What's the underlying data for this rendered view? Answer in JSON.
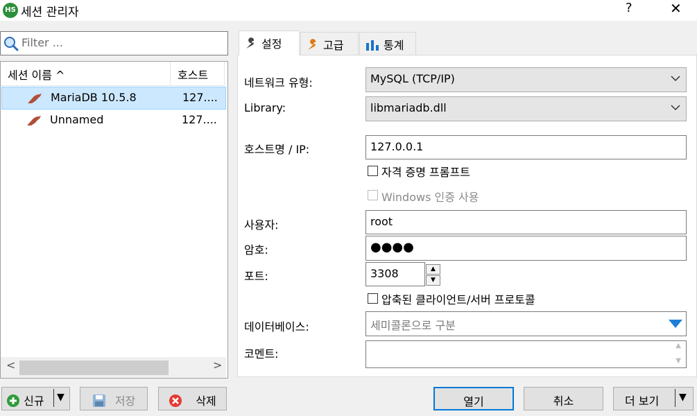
{
  "window": {
    "title": "세션 관리자",
    "help": "?",
    "close": "✕",
    "app_icon": "HS"
  },
  "filter": {
    "placeholder": "Filter ..."
  },
  "list": {
    "columns": [
      "세션 이름 ^",
      "호스트"
    ],
    "rows": [
      {
        "name": "MariaDB 10.5.8",
        "host": "127....",
        "selected": true
      },
      {
        "name": "Unnamed",
        "host": "127....",
        "selected": false
      }
    ],
    "scroll_left": "<",
    "scroll_right": ">"
  },
  "tabs": [
    {
      "label": "설정",
      "icon": "wrench-icon",
      "active": true
    },
    {
      "label": "고급",
      "icon": "wrench-orange-icon",
      "active": false
    },
    {
      "label": "통계",
      "icon": "bar-chart-icon",
      "active": false
    }
  ],
  "form": {
    "network_type_label": "네트워크 유형:",
    "network_type_value": "MySQL (TCP/IP)",
    "library_label": "Library:",
    "library_value": "libmariadb.dll",
    "host_label": "호스트명 / IP:",
    "host_value": "127.0.0.1",
    "credential_prompt_label": "자격 증명 프롬프트",
    "windows_auth_label": "Windows 인증 사용",
    "user_label": "사용자:",
    "user_value": "root",
    "password_label": "암호:",
    "password_value": "●●●●",
    "port_label": "포트:",
    "port_value": "3308",
    "compressed_label": "압축된 클라이언트/서버 프로토콜",
    "database_label": "데이터베이스:",
    "database_placeholder": "세미콜론으로 구분",
    "comment_label": "코멘트:"
  },
  "buttons": {
    "new": "신규",
    "save": "저장",
    "delete": "삭제",
    "open": "열기",
    "cancel": "취소",
    "more": "더 보기"
  }
}
